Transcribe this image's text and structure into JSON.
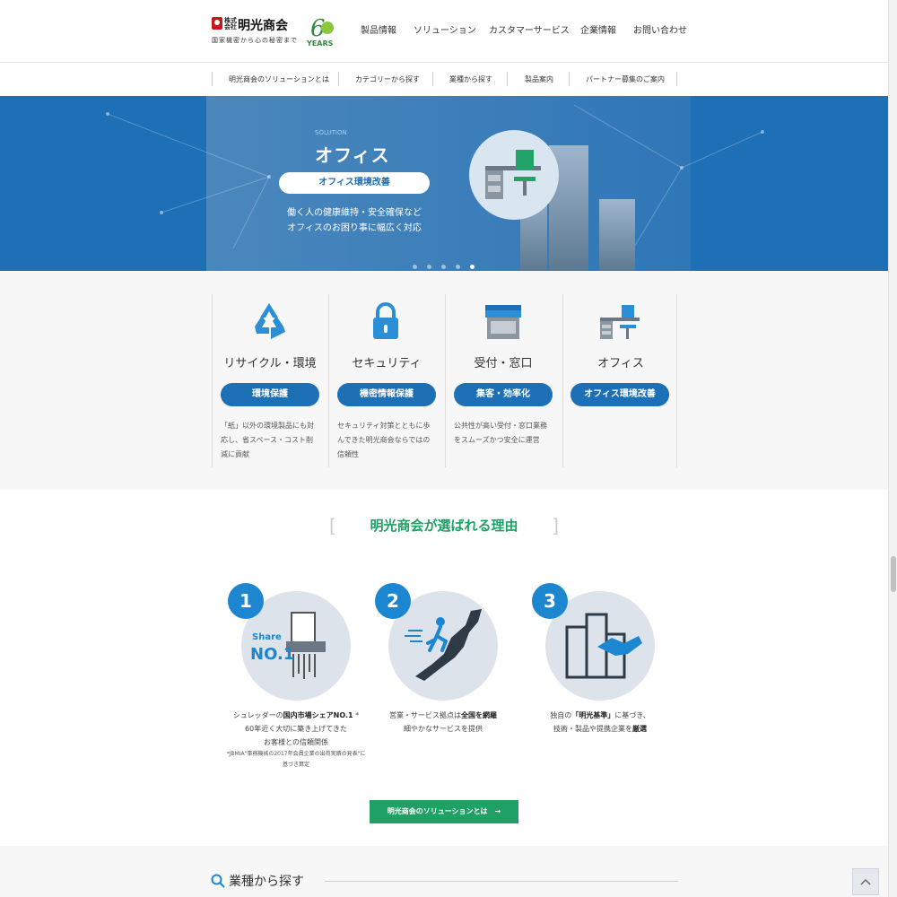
{
  "header": {
    "logo_small": "株式会社",
    "logo_main": "明光商会",
    "logo_sub": "国家機密から心の秘密まで",
    "years_number": "6",
    "years_label": "YEARS",
    "nav": [
      "製品情報",
      "ソリューション",
      "カスタマーサービス",
      "企業情報",
      "お問い合わせ"
    ]
  },
  "subnav": {
    "items": [
      "明光商会のソリューションとは",
      "カテゴリーから探す",
      "業種から探す",
      "製品案内",
      "パートナー募集のご案内"
    ]
  },
  "hero": {
    "small_label": "SOLUTION",
    "title": "オフィス",
    "button": "オフィス環境改善",
    "lines": [
      "働く人の健康維持・安全確保など",
      "オフィスのお困り事に幅広く対応"
    ],
    "slide_count": 5,
    "active_slide": 5
  },
  "categories": [
    {
      "title": "リサイクル・環境",
      "button": "環境保護",
      "desc": "「紙」以外の環境製品にも対応し、省スペース・コスト削減に貢献",
      "icon": "recycle-icon"
    },
    {
      "title": "セキュリティ",
      "button": "機密情報保護",
      "desc": "セキュリティ対策とともに歩んできた明光商会ならではの信頼性",
      "icon": "lock-icon"
    },
    {
      "title": "受付・窓口",
      "button": "集客・効率化",
      "desc": "公共性が高い受付・窓口業務をスムーズかつ安全に運営",
      "icon": "shop-icon"
    },
    {
      "title": "オフィス",
      "button": "オフィス環境改善",
      "desc": "",
      "icon": "desk-icon"
    }
  ],
  "reasons": {
    "title": "明光商会が選ばれる理由",
    "items": [
      {
        "number": "1",
        "badge_top": "Share",
        "badge_main": "NO.1",
        "line1_pre": "シュレッダーの",
        "line1_bold": "国内市場シェアNO.1",
        "line1_post": " *",
        "line2": "60年近く大切に築き上げてきた",
        "line3": "お客様との信頼関係",
        "note1": "*JBMIA\"事務機械の2017年会員企業の出荷実績の発表\"に",
        "note2": "基づき算定"
      },
      {
        "number": "2",
        "line1_pre": "営業・サービス拠点は",
        "line1_bold": "全国を網羅",
        "line1_post": "",
        "line2": "細やかなサービスを提供",
        "line3": ""
      },
      {
        "number": "3",
        "line1_pre": "独自の",
        "line1_bold": "「明光基準」",
        "line1_post": "に基づき、",
        "line2_pre": "技術・製品や提携企業を",
        "line2_bold": "厳選"
      }
    ],
    "button": "明光商会のソリューションとは　→"
  },
  "bottom": {
    "industry_title": "業種から探す"
  },
  "colors": {
    "primary_blue": "#1d6fb6",
    "accent_green": "#1fa065",
    "number_blue": "#1d86d0"
  }
}
